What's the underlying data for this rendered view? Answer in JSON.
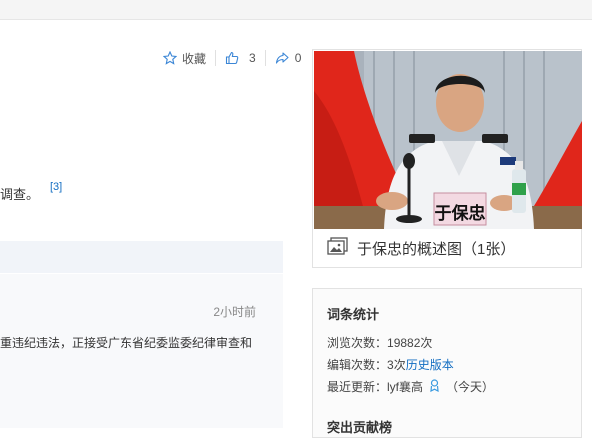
{
  "actions": {
    "favorite_label": "收藏",
    "like_count": "3",
    "share_count": "0"
  },
  "article": {
    "tail_text": "调查。",
    "ref_marker": "[3]"
  },
  "news": {
    "time": "2小时前",
    "text": "重违纪违法，正接受广东省纪委监委纪律审查和"
  },
  "photo_card": {
    "nameplate": "于保忠",
    "caption": "于保忠的概述图（1张）"
  },
  "stats": {
    "title": "词条统计",
    "views_label": "浏览次数：",
    "views_value": "19882次",
    "edits_label": "编辑次数：",
    "edits_value": "3次",
    "history_link": "历史版本",
    "updated_label": "最近更新：",
    "updated_user": "lyf襄高",
    "updated_time": "（今天）",
    "contrib_title": "突出贡献榜"
  },
  "colors": {
    "accent": "#136ec2",
    "photo_red": "#e0261b",
    "uniform": "#f2f3f5"
  },
  "icons": [
    "star-icon",
    "thumbs-up-icon",
    "share-icon",
    "image-gallery-icon",
    "user-badge-icon"
  ]
}
